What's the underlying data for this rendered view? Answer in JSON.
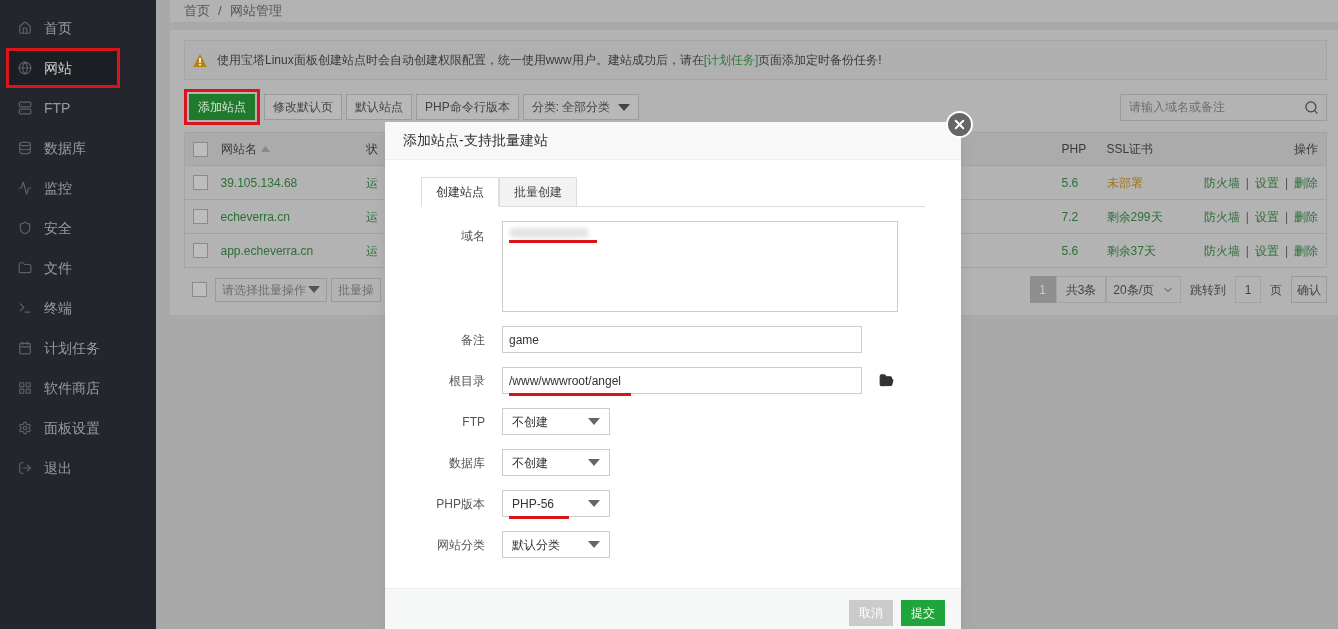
{
  "breadcrumb": {
    "items": [
      "首页",
      "网站管理"
    ],
    "separator": "/"
  },
  "sidebar": {
    "items": [
      {
        "label": "首页",
        "selected": false,
        "highlighted": false
      },
      {
        "label": "网站",
        "selected": true,
        "highlighted": true
      },
      {
        "label": "FTP",
        "selected": false,
        "highlighted": false
      },
      {
        "label": "数据库",
        "selected": false,
        "highlighted": false
      },
      {
        "label": "监控",
        "selected": false,
        "highlighted": false
      },
      {
        "label": "安全",
        "selected": false,
        "highlighted": false
      },
      {
        "label": "文件",
        "selected": false,
        "highlighted": false
      },
      {
        "label": "终端",
        "selected": false,
        "highlighted": false
      },
      {
        "label": "计划任务",
        "selected": false,
        "highlighted": false
      },
      {
        "label": "软件商店",
        "selected": false,
        "highlighted": false
      },
      {
        "label": "面板设置",
        "selected": false,
        "highlighted": false
      },
      {
        "label": "退出",
        "selected": false,
        "highlighted": false
      }
    ]
  },
  "notice": {
    "before": "使用宝塔Linux面板创建站点时会自动创建权限配置，统一使用www用户。建站成功后，请在",
    "link": "[计划任务]",
    "after": "页面添加定时备份任务!"
  },
  "toolbar": {
    "buttons": [
      {
        "label": "添加站点",
        "primary": true,
        "highlighted": true
      },
      {
        "label": "修改默认页",
        "primary": false,
        "highlighted": false
      },
      {
        "label": "默认站点",
        "primary": false,
        "highlighted": false
      },
      {
        "label": "PHP命令行版本",
        "primary": false,
        "highlighted": false
      }
    ],
    "category": "分类: 全部分类",
    "search_placeholder": "请输入域名或备注"
  },
  "table": {
    "columns": [
      "网站名",
      "状",
      "PHP",
      "SSL证书",
      "操作"
    ],
    "select_all_checked": false,
    "action_separator": "|",
    "rows": [
      {
        "checked": false,
        "name": "39.105.134.68",
        "status": "运",
        "php": "5.6",
        "ssl": "未部署",
        "ssl_warning": true,
        "actions": [
          "防火墙",
          "设置",
          "删除"
        ]
      },
      {
        "checked": false,
        "name": "echeverra.cn",
        "status": "运",
        "php": "7.2",
        "ssl": "剩余299天",
        "ssl_warning": false,
        "actions": [
          "防火墙",
          "设置",
          "删除"
        ]
      },
      {
        "checked": false,
        "name": "app.echeverra.cn",
        "status": "运",
        "php": "5.6",
        "ssl": "剩余37天",
        "ssl_warning": false,
        "actions": [
          "防火墙",
          "设置",
          "删除"
        ]
      }
    ]
  },
  "bulk": {
    "checked": false,
    "placeholder": "请选择批量操作",
    "button": "批量操"
  },
  "pagination": {
    "pages": [
      {
        "label": "1",
        "selected": true
      }
    ],
    "total": "共3条",
    "per_page": "20条/页",
    "jump_label": "跳转到",
    "jump_value": "1",
    "page_unit": "页",
    "confirm": "确认"
  },
  "dialog": {
    "title": "添加站点-支持批量建站",
    "tabs": [
      {
        "label": "创建站点",
        "selected": true
      },
      {
        "label": "批量创建",
        "selected": false
      }
    ],
    "fields": [
      {
        "kind": "textarea",
        "label": "域名",
        "redacted": true,
        "underlined": true
      },
      {
        "kind": "input",
        "label": "备注",
        "value": "game",
        "underlined": false
      },
      {
        "kind": "path",
        "label": "根目录",
        "value": "/www/wwwroot/angel",
        "underlined": true
      },
      {
        "kind": "select",
        "label": "FTP",
        "value": "不创建",
        "underlined": false
      },
      {
        "kind": "select",
        "label": "数据库",
        "value": "不创建",
        "underlined": false
      },
      {
        "kind": "select",
        "label": "PHP版本",
        "value": "PHP-56",
        "underlined": true
      },
      {
        "kind": "select",
        "label": "网站分类",
        "value": "默认分类",
        "underlined": false
      }
    ],
    "buttons": [
      {
        "label": "取消",
        "kind": "cancel"
      },
      {
        "label": "提交",
        "kind": "submit"
      }
    ]
  }
}
